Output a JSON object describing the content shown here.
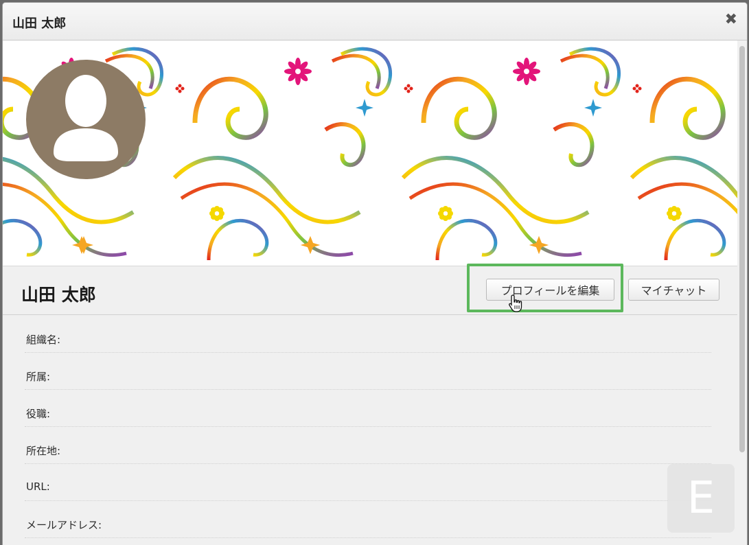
{
  "dialog": {
    "title": "山田 太郎",
    "close_icon": "close-icon"
  },
  "profile": {
    "name": "山田 太郎",
    "avatar_icon": "default-user-silhouette-icon",
    "cover_pattern": "rainbow-swirl-floral"
  },
  "actions": {
    "edit_label": "プロフィールを編集",
    "chat_label": "マイチャット",
    "highlight_color": "#5cb85c"
  },
  "fields": [
    {
      "label": "組織名:"
    },
    {
      "label": "所属:"
    },
    {
      "label": "役職:"
    },
    {
      "label": "所在地:"
    },
    {
      "label": "URL:"
    },
    {
      "label": "メールアドレス:"
    }
  ],
  "watermark": {
    "letter": "E"
  },
  "colors": {
    "avatar_bg": "#8d7b65",
    "swirl_colors": [
      "#e2231a",
      "#f5a623",
      "#f8d800",
      "#7ac143",
      "#2e9ad0",
      "#8e44ad"
    ],
    "flower_magenta": "#e3157a",
    "flower_yellow": "#f5d800"
  }
}
